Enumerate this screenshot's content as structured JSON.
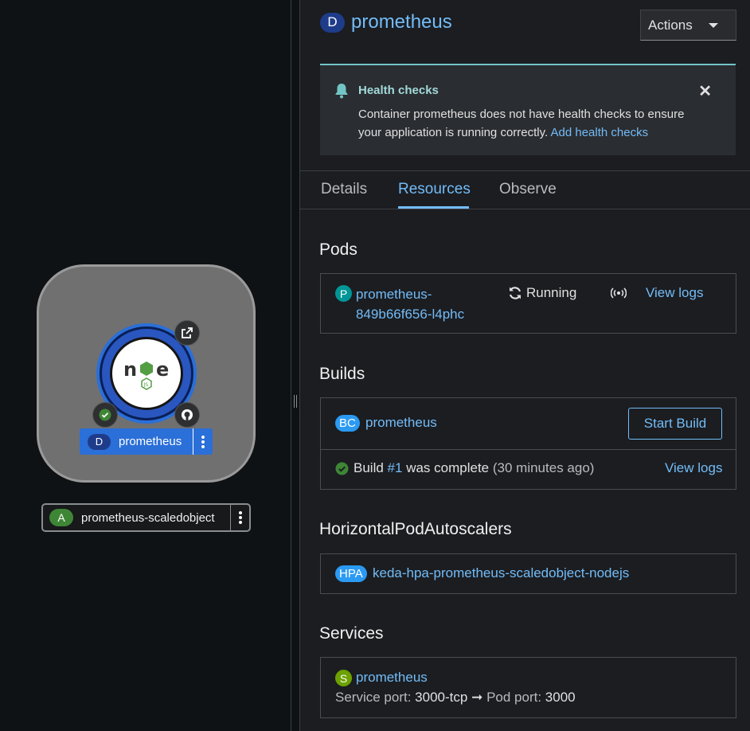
{
  "topology": {
    "node": {
      "badge": "D",
      "name": "prometheus",
      "runtime_icon": "nodejs-icon"
    },
    "scaled_object": {
      "badge": "A",
      "name": "prometheus-scaledobject"
    }
  },
  "panel": {
    "title_badge": "D",
    "title": "prometheus",
    "actions_label": "Actions",
    "alert": {
      "title": "Health checks",
      "body": "Container prometheus does not have health checks to ensure your application is running correctly.",
      "link": "Add health checks"
    },
    "tabs": [
      "Details",
      "Resources",
      "Observe"
    ],
    "active_tab": "Resources",
    "pods": {
      "heading": "Pods",
      "badge": "P",
      "name_line1": "prometheus-",
      "name_line2": "849b66f656-l4phc",
      "status": "Running",
      "view_logs": "View logs"
    },
    "builds": {
      "heading": "Builds",
      "badge": "BC",
      "name": "prometheus",
      "start_build": "Start Build",
      "build_prefix": "Build",
      "build_number": "#1",
      "build_suffix": "was complete",
      "build_time": "(30 minutes ago)",
      "view_logs": "View logs"
    },
    "hpa": {
      "heading": "HorizontalPodAutoscalers",
      "badge": "HPA",
      "name": "keda-hpa-prometheus-scaledobject-nodejs"
    },
    "services": {
      "heading": "Services",
      "badge": "S",
      "name": "prometheus",
      "service_port_label": "Service port:",
      "service_port": "3000-tcp",
      "pod_port_label": "Pod port:",
      "pod_port": "3000"
    }
  },
  "colors": {
    "link": "#73bcf7",
    "success": "#3e8635",
    "deployment_badge": "#1f3c8a",
    "bc_badge": "#2b9af3",
    "service_badge": "#6ca100",
    "pod_badge": "#009596"
  }
}
